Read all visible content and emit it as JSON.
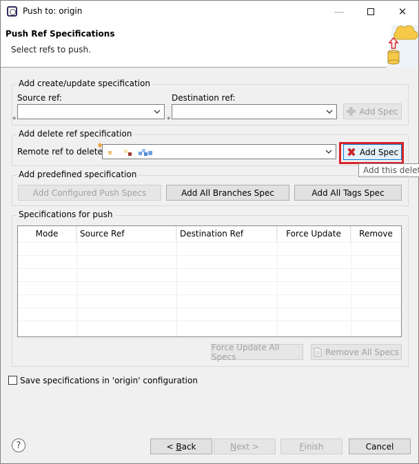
{
  "window": {
    "title": "Push to: origin",
    "minimize_glyph": "—",
    "close_glyph": "✕"
  },
  "banner": {
    "title": "Push Ref Specifications",
    "subtitle": "Select refs to push."
  },
  "create_update": {
    "group_label": "Add create/update specification",
    "source_label": "Source ref:",
    "source_value": "",
    "destination_label": "Destination ref:",
    "destination_value": "",
    "add_spec_label": "Add Spec",
    "required_marker": "*"
  },
  "delete_ref": {
    "group_label": "Add delete ref specification",
    "remote_label": "Remote ref to delete:",
    "remote_value": "",
    "add_spec_label": "Add Spec",
    "tooltip": "Add this delete"
  },
  "predefined": {
    "group_label": "Add predefined specification",
    "configured_label": "Add Configured Push Specs",
    "branches_label": "Add All Branches Spec",
    "tags_label": "Add All Tags Spec"
  },
  "specs": {
    "group_label": "Specifications for push",
    "columns": [
      "Mode",
      "Source Ref",
      "Destination Ref",
      "Force Update",
      "Remove"
    ],
    "rows": [],
    "force_update_all_label": "Force Update All Specs",
    "remove_all_label": "Remove All Specs"
  },
  "save_config": {
    "label": "Save specifications in 'origin' configuration",
    "checked": false
  },
  "footer": {
    "help_glyph": "?",
    "back_label_pre": "< ",
    "back_mnemonic": "B",
    "back_label_post": "ack",
    "next_mnemonic": "N",
    "next_label_post": "ext >",
    "finish_mnemonic": "F",
    "finish_label_post": "inish",
    "cancel_label": "Cancel"
  },
  "colors": {
    "highlight_border": "#d9222a",
    "delete_icon": "#d9222a",
    "cloud": "#f7c948",
    "arrow": "#d9222a"
  },
  "icons": {
    "app": "eclipse-icon",
    "banner": "cloud-push-icon",
    "add_disabled": "add-icon",
    "delete": "red-x-icon",
    "chevron": "chevron-down-icon",
    "help": "help-icon"
  }
}
